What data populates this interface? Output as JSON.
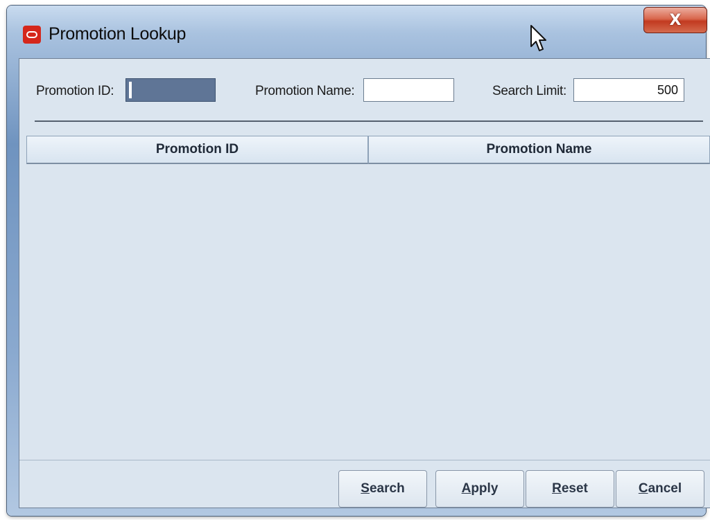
{
  "window": {
    "title": "Promotion Lookup",
    "close_glyph": "X",
    "icon": "oracle-logo-icon"
  },
  "search": {
    "promotion_id_label": "Promotion ID:",
    "promotion_id_value": "",
    "promotion_name_label": "Promotion Name:",
    "promotion_name_value": "",
    "search_limit_label": "Search Limit:",
    "search_limit_value": "500"
  },
  "table": {
    "columns": [
      "Promotion ID",
      "Promotion Name"
    ],
    "rows": []
  },
  "buttons": {
    "search": {
      "mnemonic": "S",
      "rest": "earch"
    },
    "apply": {
      "mnemonic": "A",
      "rest": "pply"
    },
    "reset": {
      "mnemonic": "R",
      "rest": "eset"
    },
    "cancel": {
      "mnemonic": "C",
      "rest": "ancel"
    }
  },
  "colors": {
    "accent_close": "#c23a20",
    "brand_icon": "#d5271b",
    "panel_bg": "#dbe5ef",
    "focused_field": "#5f7596"
  }
}
